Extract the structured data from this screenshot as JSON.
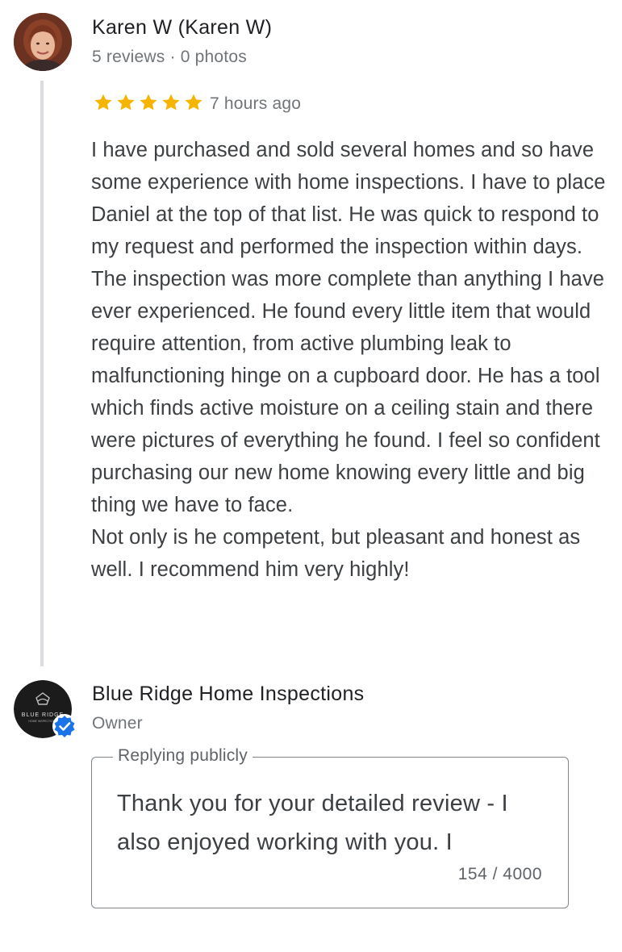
{
  "review": {
    "reviewer_name": "Karen W (Karen W)",
    "reviewer_stats": "5 reviews · 0 photos",
    "rating": 5,
    "star_color": "#f5b400",
    "time_ago": "7 hours ago",
    "paragraphs": [
      "I have purchased and sold several homes and so have some experience with home inspections. I have to place Daniel at the top of that list. He was quick to respond to my request and performed the inspection within days. The inspection was more complete than anything I have ever experienced. He found every little item that would require attention, from active plumbing leak to malfunctioning hinge on a cupboard door. He has a tool which finds active moisture on a ceiling stain and there were pictures of everything he found. I feel so confident purchasing our new home knowing every little and big thing we have to face.",
      "Not only is he competent, but pleasant and honest as well. I recommend him very highly!"
    ]
  },
  "owner": {
    "business_name": "Blue Ridge Home Inspections",
    "role": "Owner",
    "logo_text": "BLUE RIDGE",
    "logo_subtext": "HOME INSPECTIONS",
    "verified_color": "#1a73e8"
  },
  "reply": {
    "legend": "Replying publicly",
    "text": "Thank you for your detailed review - I also enjoyed working with you. I",
    "counter": "154 / 4000"
  }
}
